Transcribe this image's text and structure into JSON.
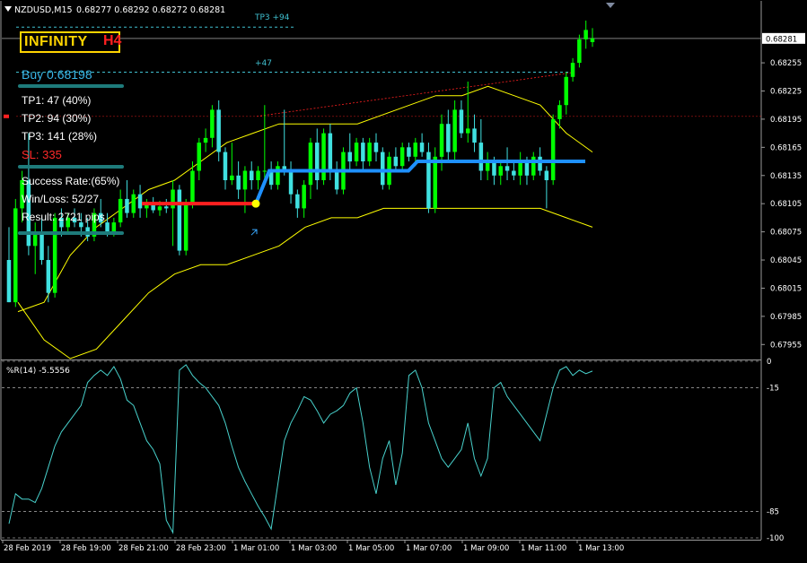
{
  "header": {
    "symbol": "NZDUSD,M15",
    "ohlc": "0.68277 0.68292 0.68272 0.68281"
  },
  "logo": {
    "main": "INFINITY",
    "sub": "H4"
  },
  "signal_panel": {
    "buy": "Buy 0.68198",
    "tp1": "TP1: 47 (40%)",
    "tp2": "TP2: 94 (30%)",
    "tp3": "TP3: 141 (28%)",
    "sl": "SL: 335",
    "success": "Success Rate:(65%)",
    "winloss": "Win/Loss: 52/27",
    "result": "Result: 2721 pips"
  },
  "chart_labels": {
    "tp_top": "TP3 +94",
    "tp_mid": "+47"
  },
  "colors": {
    "bull": "#00ff00",
    "bear": "#40e0e0",
    "band": "#ffff00",
    "trend": "#1e90ff",
    "stop": "#ff2020",
    "wpr": "#48d1cc"
  },
  "indicator": {
    "label": "%R(14) -5.5556",
    "levels": [
      0,
      -15,
      -85,
      -100
    ]
  },
  "chart_data": [
    {
      "type": "candlestick",
      "title": "NZDUSD,M15",
      "current_price": 0.68281,
      "ylim": [
        0.6794,
        0.6832
      ],
      "y_ticks": [
        0.68255,
        0.68225,
        0.68195,
        0.68165,
        0.68135,
        0.68105,
        0.68075,
        0.68045,
        0.68015,
        0.67985,
        0.67955
      ],
      "x_ticks": [
        "28 Feb 2019",
        "28 Feb 19:00",
        "28 Feb 21:00",
        "28 Feb 23:00",
        "1 Mar 01:00",
        "1 Mar 03:00",
        "1 Mar 05:00",
        "1 Mar 07:00",
        "1 Mar 09:00",
        "1 Mar 11:00",
        "1 Mar 13:00"
      ],
      "candles": [
        [
          0.68045,
          0.6808,
          0.68,
          0.68
        ],
        [
          0.68,
          0.6811,
          0.67995,
          0.681
        ],
        [
          0.681,
          0.6814,
          0.68085,
          0.6813
        ],
        [
          0.6813,
          0.6818,
          0.6805,
          0.6806
        ],
        [
          0.6806,
          0.68085,
          0.6803,
          0.68075
        ],
        [
          0.68075,
          0.6809,
          0.6804,
          0.68045
        ],
        [
          0.68045,
          0.6806,
          0.68,
          0.6801
        ],
        [
          0.6801,
          0.68095,
          0.68005,
          0.6809
        ],
        [
          0.6809,
          0.681,
          0.6807,
          0.6808
        ],
        [
          0.6808,
          0.68095,
          0.68075,
          0.6809
        ],
        [
          0.6809,
          0.681,
          0.6808,
          0.68085
        ],
        [
          0.68085,
          0.68095,
          0.6807,
          0.6808
        ],
        [
          0.6808,
          0.6809,
          0.68065,
          0.6807
        ],
        [
          0.6807,
          0.681,
          0.68065,
          0.68095
        ],
        [
          0.68095,
          0.6811,
          0.6808,
          0.68085
        ],
        [
          0.68085,
          0.68095,
          0.6807,
          0.68075
        ],
        [
          0.68075,
          0.6809,
          0.6807,
          0.68085
        ],
        [
          0.68085,
          0.6812,
          0.6808,
          0.6811
        ],
        [
          0.6811,
          0.6813,
          0.6809,
          0.68095
        ],
        [
          0.68095,
          0.6812,
          0.6809,
          0.68115
        ],
        [
          0.68115,
          0.68125,
          0.6809,
          0.681
        ],
        [
          0.681,
          0.6811,
          0.6809,
          0.68105
        ],
        [
          0.68105,
          0.68112,
          0.68095,
          0.68098
        ],
        [
          0.68098,
          0.68108,
          0.68092,
          0.68102
        ],
        [
          0.68102,
          0.6811,
          0.68095,
          0.681
        ],
        [
          0.681,
          0.6813,
          0.6806,
          0.6812
        ],
        [
          0.6812,
          0.68125,
          0.6805,
          0.68055
        ],
        [
          0.68055,
          0.6811,
          0.6805,
          0.68105
        ],
        [
          0.68105,
          0.6815,
          0.681,
          0.6814
        ],
        [
          0.6814,
          0.68175,
          0.6813,
          0.6817
        ],
        [
          0.6817,
          0.68185,
          0.6816,
          0.68175
        ],
        [
          0.68175,
          0.6821,
          0.68165,
          0.68205
        ],
        [
          0.68205,
          0.68215,
          0.6815,
          0.6816
        ],
        [
          0.6816,
          0.68165,
          0.6812,
          0.6813
        ],
        [
          0.6813,
          0.6817,
          0.68125,
          0.68135
        ],
        [
          0.68135,
          0.6815,
          0.6811,
          0.6812
        ],
        [
          0.6812,
          0.68145,
          0.68095,
          0.6814
        ],
        [
          0.6814,
          0.6815,
          0.6812,
          0.6813
        ],
        [
          0.6813,
          0.68145,
          0.6812,
          0.6814
        ],
        [
          0.6814,
          0.6821,
          0.6813,
          0.6814
        ],
        [
          0.6814,
          0.6815,
          0.6812,
          0.68125
        ],
        [
          0.68125,
          0.6815,
          0.6812,
          0.68145
        ],
        [
          0.68145,
          0.68205,
          0.68135,
          0.6814
        ],
        [
          0.6814,
          0.6815,
          0.68105,
          0.68115
        ],
        [
          0.68115,
          0.6812,
          0.6809,
          0.681
        ],
        [
          0.681,
          0.6813,
          0.6809,
          0.68125
        ],
        [
          0.68125,
          0.68175,
          0.6811,
          0.6817
        ],
        [
          0.6817,
          0.68185,
          0.6812,
          0.6813
        ],
        [
          0.6813,
          0.68185,
          0.68125,
          0.6818
        ],
        [
          0.6818,
          0.6819,
          0.6813,
          0.6814
        ],
        [
          0.6814,
          0.6815,
          0.68115,
          0.6812
        ],
        [
          0.6812,
          0.68165,
          0.68115,
          0.6816
        ],
        [
          0.6816,
          0.6818,
          0.6814,
          0.6815
        ],
        [
          0.6815,
          0.68175,
          0.68145,
          0.6817
        ],
        [
          0.6817,
          0.68175,
          0.6814,
          0.6815
        ],
        [
          0.6815,
          0.68175,
          0.68145,
          0.6817
        ],
        [
          0.6817,
          0.6818,
          0.6815,
          0.6816
        ],
        [
          0.6816,
          0.68165,
          0.6812,
          0.68125
        ],
        [
          0.68125,
          0.6816,
          0.6812,
          0.68155
        ],
        [
          0.68155,
          0.68165,
          0.6814,
          0.68145
        ],
        [
          0.68145,
          0.6817,
          0.6814,
          0.68165
        ],
        [
          0.68165,
          0.6817,
          0.6815,
          0.68155
        ],
        [
          0.68155,
          0.68175,
          0.68145,
          0.6817
        ],
        [
          0.6817,
          0.6818,
          0.68155,
          0.6816
        ],
        [
          0.6816,
          0.6817,
          0.68095,
          0.681
        ],
        [
          0.681,
          0.68165,
          0.68095,
          0.68155
        ],
        [
          0.68155,
          0.682,
          0.6814,
          0.6819
        ],
        [
          0.6819,
          0.68205,
          0.6815,
          0.6816
        ],
        [
          0.6816,
          0.68215,
          0.6815,
          0.68205
        ],
        [
          0.68205,
          0.68215,
          0.68175,
          0.6818
        ],
        [
          0.6818,
          0.68235,
          0.6817,
          0.68185
        ],
        [
          0.68185,
          0.682,
          0.6816,
          0.6817
        ],
        [
          0.6817,
          0.68195,
          0.6813,
          0.6814
        ],
        [
          0.6814,
          0.6816,
          0.6813,
          0.6815
        ],
        [
          0.6815,
          0.68155,
          0.68125,
          0.68135
        ],
        [
          0.68135,
          0.6815,
          0.68125,
          0.68145
        ],
        [
          0.68145,
          0.68165,
          0.6813,
          0.6814
        ],
        [
          0.6814,
          0.6815,
          0.6813,
          0.68135
        ],
        [
          0.68135,
          0.6816,
          0.68125,
          0.6815
        ],
        [
          0.6815,
          0.68155,
          0.68125,
          0.68135
        ],
        [
          0.68135,
          0.6816,
          0.6813,
          0.68155
        ],
        [
          0.68155,
          0.68165,
          0.68135,
          0.6814
        ],
        [
          0.6814,
          0.68145,
          0.681,
          0.6813
        ],
        [
          0.6813,
          0.682,
          0.68125,
          0.68195
        ],
        [
          0.68195,
          0.68215,
          0.68185,
          0.6821
        ],
        [
          0.6821,
          0.68245,
          0.682,
          0.6824
        ],
        [
          0.6824,
          0.6826,
          0.68235,
          0.68255
        ],
        [
          0.68255,
          0.68285,
          0.6825,
          0.6828
        ],
        [
          0.6828,
          0.683,
          0.6827,
          0.6829
        ],
        [
          0.68277,
          0.68292,
          0.68272,
          0.68281
        ]
      ],
      "band_upper": [
        0.6799,
        0.68,
        0.6805,
        0.6808,
        0.681,
        0.6812,
        0.6813,
        0.6815,
        0.6817,
        0.6818,
        0.6819,
        0.6819,
        0.6819,
        0.6819,
        0.682,
        0.6821,
        0.6822,
        0.6822,
        0.6823,
        0.6822,
        0.6821,
        0.6818,
        0.6816
      ],
      "band_lower": [
        0.68,
        0.6796,
        0.6794,
        0.6795,
        0.6798,
        0.6801,
        0.6803,
        0.6804,
        0.6804,
        0.6805,
        0.6806,
        0.6808,
        0.6809,
        0.6809,
        0.681,
        0.681,
        0.681,
        0.681,
        0.681,
        0.681,
        0.681,
        0.6809,
        0.6808
      ],
      "trend_line": [
        [
          0.6814,
          0.6814
        ],
        [
          0.6814,
          0.6814
        ],
        [
          0.6815,
          0.6815
        ],
        [
          0.6815,
          0.6815
        ]
      ],
      "buy_entry": 0.68105,
      "tp_levels": [
        0.68245,
        0.68293
      ],
      "reference_price": 0.68198
    },
    {
      "type": "line",
      "title": "%R(14) -5.5556",
      "ylim": [
        -100,
        0
      ],
      "y_ticks": [
        0,
        -15,
        -85,
        -100
      ],
      "series": [
        {
          "values": [
            -92,
            -75,
            -78,
            -78,
            -80,
            -72,
            -60,
            -48,
            -40,
            -35,
            -30,
            -25,
            -12,
            -8,
            -5,
            -8,
            -3,
            -10,
            -22,
            -25,
            -35,
            -45,
            -50,
            -58,
            -90,
            -97,
            -5,
            -2,
            -8,
            -12,
            -15,
            -20,
            -25,
            -35,
            -48,
            -60,
            -68,
            -75,
            -82,
            -88,
            -95,
            -70,
            -45,
            -35,
            -28,
            -20,
            -22,
            -28,
            -35,
            -30,
            -28,
            -25,
            -18,
            -15,
            -35,
            -60,
            -75,
            -55,
            -45,
            -70,
            -52,
            -8,
            -5,
            -15,
            -35,
            -45,
            -55,
            -60,
            -55,
            -50,
            -35,
            -55,
            -65,
            -55,
            -15,
            -12,
            -20,
            -25,
            -30,
            -35,
            -40,
            -45,
            -30,
            -15,
            -5,
            -3,
            -8,
            -5,
            -7,
            -5.5556
          ]
        }
      ]
    }
  ]
}
